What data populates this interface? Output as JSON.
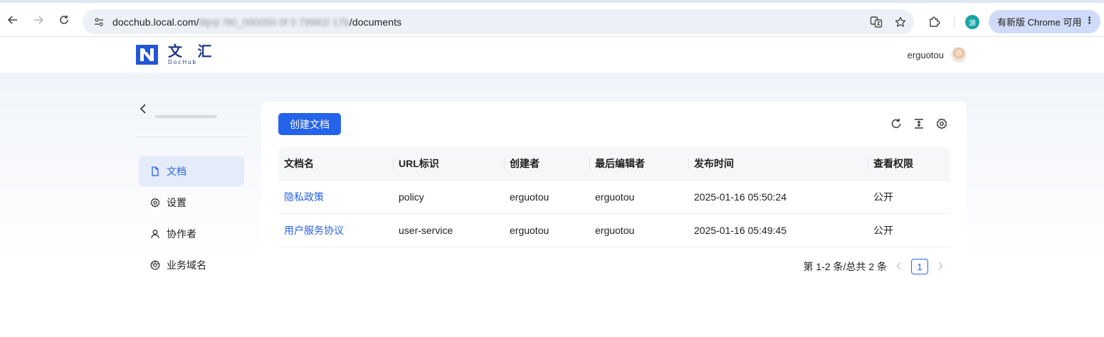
{
  "browser": {
    "url_start": "docchub.local.com/",
    "url_hidden": "ittjnj/ /90_090050 0f 0 79982/ 17b",
    "url_end": "/documents",
    "update_label": "有新版 Chrome 可用",
    "profile_initial": "源"
  },
  "header": {
    "logo_cn": "文 汇",
    "logo_en": "DocHub",
    "username": "erguotou"
  },
  "sidebar": {
    "back_title": "",
    "items": [
      {
        "label": "文档",
        "icon": "document-icon",
        "active": true
      },
      {
        "label": "设置",
        "icon": "gear-icon",
        "active": false
      },
      {
        "label": "协作者",
        "icon": "user-icon",
        "active": false
      },
      {
        "label": "业务域名",
        "icon": "globe-icon",
        "active": false
      }
    ]
  },
  "toolbar": {
    "create_label": "创建文档"
  },
  "table": {
    "columns": [
      "文档名",
      "URL标识",
      "创建者",
      "最后编辑者",
      "发布时间",
      "查看权限"
    ],
    "rows": [
      [
        "隐私政策",
        "policy",
        "erguotou",
        "erguotou",
        "2025-01-16 05:50:24",
        "公开"
      ],
      [
        "用户服务协议",
        "user-service",
        "erguotou",
        "erguotou",
        "2025-01-16 05:49:45",
        "公开"
      ]
    ]
  },
  "pagination": {
    "summary": "第 1-2 条/总共 2 条",
    "current_page": "1"
  },
  "colors": {
    "primary": "#2563eb",
    "logo": "#1f3a8a"
  }
}
